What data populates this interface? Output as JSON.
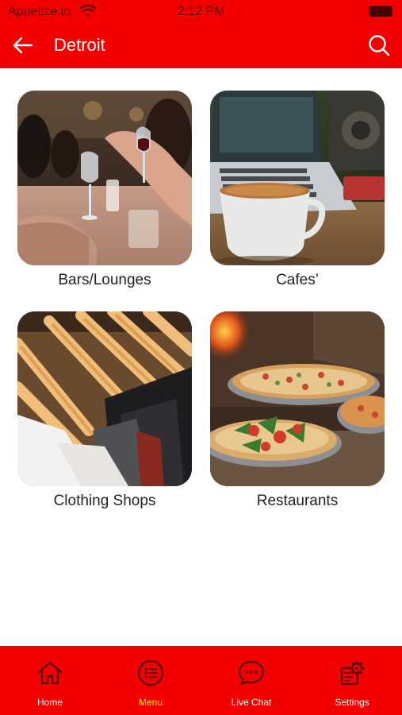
{
  "status_bar": {
    "carrier": "Appetize.io",
    "time": "2:12 PM"
  },
  "header": {
    "title": "Detroit",
    "back_icon": "arrow-left-icon",
    "search_icon": "search-icon"
  },
  "colors": {
    "brand_red": "#f50000",
    "active_tab": "#ffe600",
    "tab_text": "#ffffff"
  },
  "categories": [
    {
      "label": "Bars/Lounges",
      "image": "bar-photo"
    },
    {
      "label": "Cafes’",
      "image": "cafe-photo"
    },
    {
      "label": "Clothing Shops",
      "image": "clothing-photo"
    },
    {
      "label": "Restaurants",
      "image": "restaurant-photo"
    }
  ],
  "tab_bar": {
    "active": "Menu",
    "tabs": [
      {
        "label": "Home",
        "icon": "home-icon"
      },
      {
        "label": "Menu",
        "icon": "menu-list-icon"
      },
      {
        "label": "Live Chat",
        "icon": "chat-bubble-icon"
      },
      {
        "label": "Settings",
        "icon": "settings-gear-icon"
      }
    ]
  }
}
